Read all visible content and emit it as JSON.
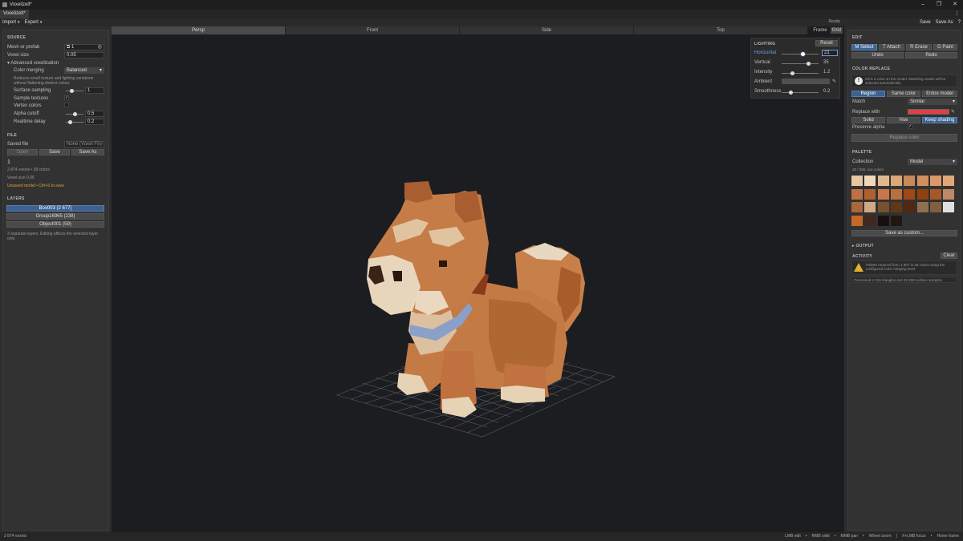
{
  "app": {
    "title": "Voxelizelt*",
    "doc_tab": "Voxelizelt*"
  },
  "menu": {
    "import": "Import",
    "export": "Export"
  },
  "header": {
    "status": "Ready",
    "save": "Save",
    "save_as": "Save As",
    "help": "?"
  },
  "source": {
    "title": "SOURCE",
    "mesh_label": "Mesh or prefab",
    "mesh_value": "1",
    "voxel_size_label": "Voxel size",
    "voxel_size_value": "0.05",
    "advanced_label": "Advanced voxelization",
    "color_merging_label": "Color merging",
    "color_merging_value": "Balanced",
    "color_merging_note": "Reduces small texture and lighting variations without flattening distinct colors.",
    "surface_sampling_label": "Surface sampling",
    "surface_sampling_value": "1",
    "sample_textures_label": "Sample textures",
    "vertex_colors_label": "Vertex colors",
    "alpha_cutoff_label": "Alpha cutoff",
    "alpha_cutoff_value": "0.5",
    "realtime_delay_label": "Realtime delay",
    "realtime_delay_value": "0.2"
  },
  "file": {
    "title": "FILE",
    "saved_file_label": "Saved file",
    "saved_file_value": "None (Voxel Fil",
    "open": "Open",
    "save": "Save",
    "save_as": "Save As",
    "model_name": "1",
    "stats": "2 874 voxels  •  28 colors",
    "voxel_size": "Voxel size  0,05",
    "unsaved": "Unsaved model  •  Ctrl+S to save"
  },
  "layers": {
    "title": "LAYERS",
    "items": [
      "Box003  (2 677)",
      "Group16965  (238)",
      "Object001  (59)"
    ],
    "note": "3 separate layers. Editing affects the selected layer only."
  },
  "viewport": {
    "tabs": [
      "Persp",
      "Front",
      "Side",
      "Top"
    ],
    "frame": "Frame",
    "grid": "Grid"
  },
  "lighting": {
    "title": "LIGHTING",
    "reset": "Reset",
    "horizontal_label": "Horizontal",
    "horizontal_value": "21",
    "vertical_label": "Vertical",
    "vertical_value": "35",
    "intensity_label": "Intensity",
    "intensity_value": "1.2",
    "ambient_label": "Ambient",
    "smoothness_label": "Smoothness",
    "smoothness_value": "0.2"
  },
  "edit": {
    "title": "EDIT",
    "m_select": "M Select",
    "t_attach": "T Attach",
    "r_erase": "R Erase",
    "g_paint": "G Paint",
    "undo": "Undo",
    "redo": "Redo"
  },
  "color_replace": {
    "title": "COLOR REPLACE",
    "hint": "Click a color on the model. Matching voxels will be selected automatically.",
    "region": "Region",
    "same_color": "Same color",
    "entire_model": "Entire model",
    "match_label": "Match",
    "match_value": "Similar",
    "replace_with_label": "Replace with",
    "solid": "Solid",
    "hue": "Hue",
    "keep_shading": "Keep shading",
    "preserve_alpha_label": "Preserve alpha",
    "replace_button": "Replace color",
    "replace_color": "#e04040"
  },
  "palette": {
    "title": "PALETTE",
    "collection_label": "Collection",
    "collection_value": "Model",
    "count": "28 / 255 .vox colors",
    "save_custom": "Save as custom...",
    "colors": [
      "#e8c8a0",
      "#f0d8b8",
      "#e0b890",
      "#d8a878",
      "#c88858",
      "#d09060",
      "#d89868",
      "#e0a878",
      "#c07040",
      "#b06030",
      "#c87848",
      "#b87040",
      "#a04818",
      "#904010",
      "#a85828",
      "#c08868",
      "#a86838",
      "#d0a888",
      "#785030",
      "#603818",
      "#502810",
      "#907050",
      "#806040",
      "#e0e0e0",
      "#c86828",
      "#402820",
      "#181010",
      "#201810"
    ]
  },
  "output": {
    "title": "OUTPUT"
  },
  "activity": {
    "title": "ACTIVITY",
    "clear": "Clear",
    "msg1": "Palette reduced from 1 807 to 28 colors using the configured Color merging level.",
    "msg2": "Processed 4 316 triangles and 49 208 surface samples."
  },
  "statusbar": {
    "voxels": "2 874 voxels",
    "hint1": "LMB edit",
    "hint2": "RMB orbit",
    "hint3": "MMB pan",
    "hint4": "Wheel zoom",
    "hint5": "X+LMB focus",
    "hint6": "Home frame"
  }
}
